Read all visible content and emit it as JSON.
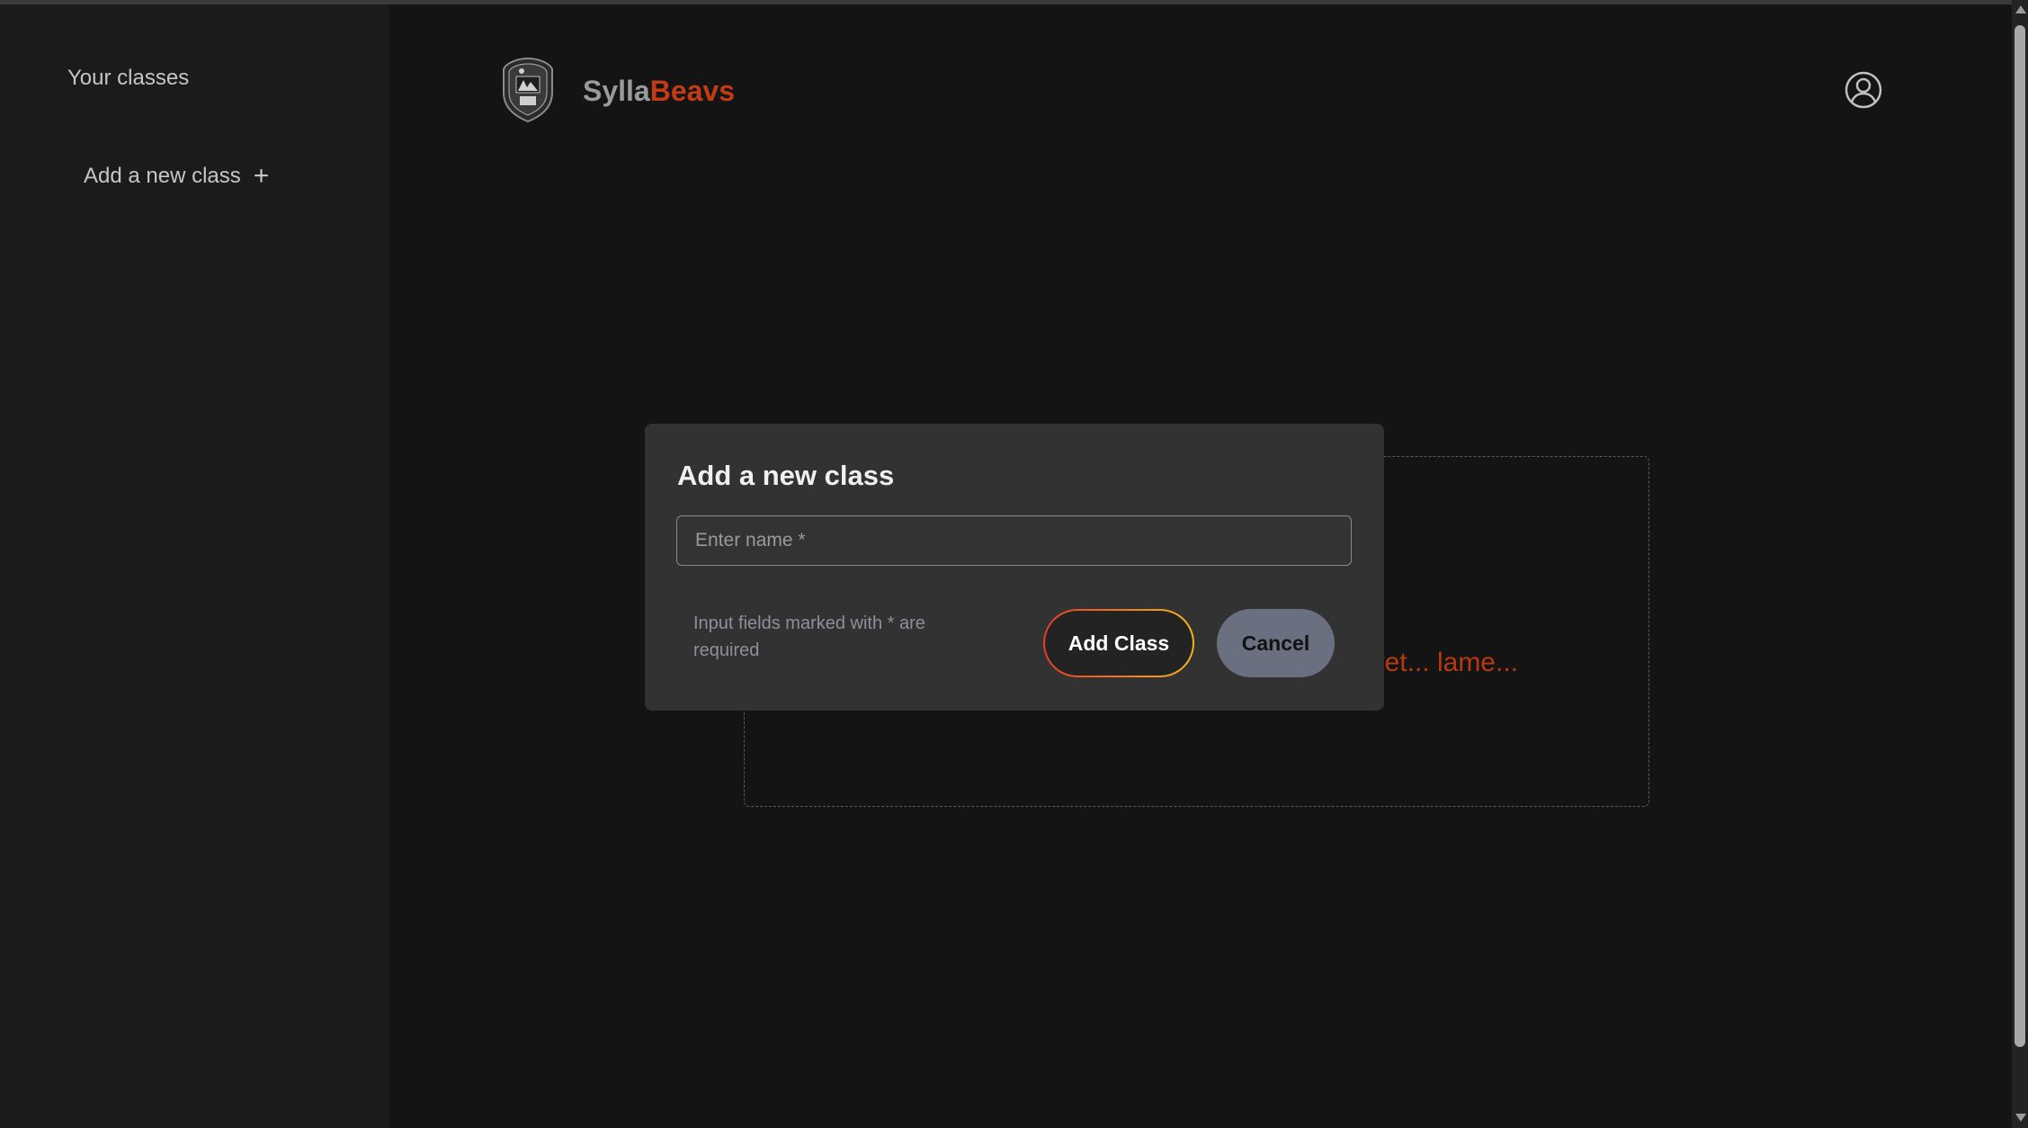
{
  "sidebar": {
    "heading": "Your classes",
    "add_class_label": "Add a new class",
    "add_icon": "plus-icon"
  },
  "header": {
    "brand_part1": "Sylla",
    "brand_part2": "Beavs",
    "logo_icon": "crest-logo-icon",
    "user_icon": "user-circle-icon"
  },
  "main": {
    "empty_message_visible": "yet... lame..."
  },
  "modal": {
    "title": "Add a new class",
    "name_placeholder": "Enter name *",
    "name_value": "",
    "required_note": "Input fields marked with * are required",
    "add_button_label": "Add Class",
    "cancel_button_label": "Cancel"
  },
  "colors": {
    "background": "#141414",
    "sidebar": "#1b1b1b",
    "modal": "#323232",
    "brand_accent": "#c23b14",
    "add_button_gradient_start": "#e43d2a",
    "add_button_gradient_end": "#f2b418",
    "cancel_button": "#6b7080"
  }
}
